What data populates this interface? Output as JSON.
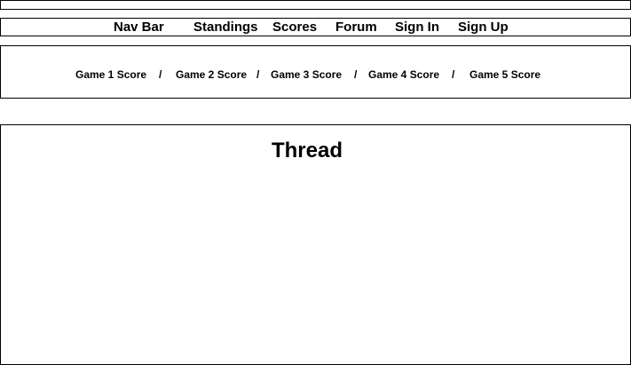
{
  "nav": {
    "title": "Nav Bar",
    "items": [
      {
        "label": "Standings"
      },
      {
        "label": "Scores"
      },
      {
        "label": "Forum"
      },
      {
        "label": "Sign In"
      },
      {
        "label": "Sign Up"
      }
    ]
  },
  "scores_bar": {
    "items": [
      {
        "label": "Game 1 Score"
      },
      {
        "label": "Game 2 Score"
      },
      {
        "label": "Game 3 Score"
      },
      {
        "label": "Game 4 Score"
      },
      {
        "label": "Game 5 Score"
      }
    ],
    "separator": "/"
  },
  "thread": {
    "title": "Thread"
  }
}
